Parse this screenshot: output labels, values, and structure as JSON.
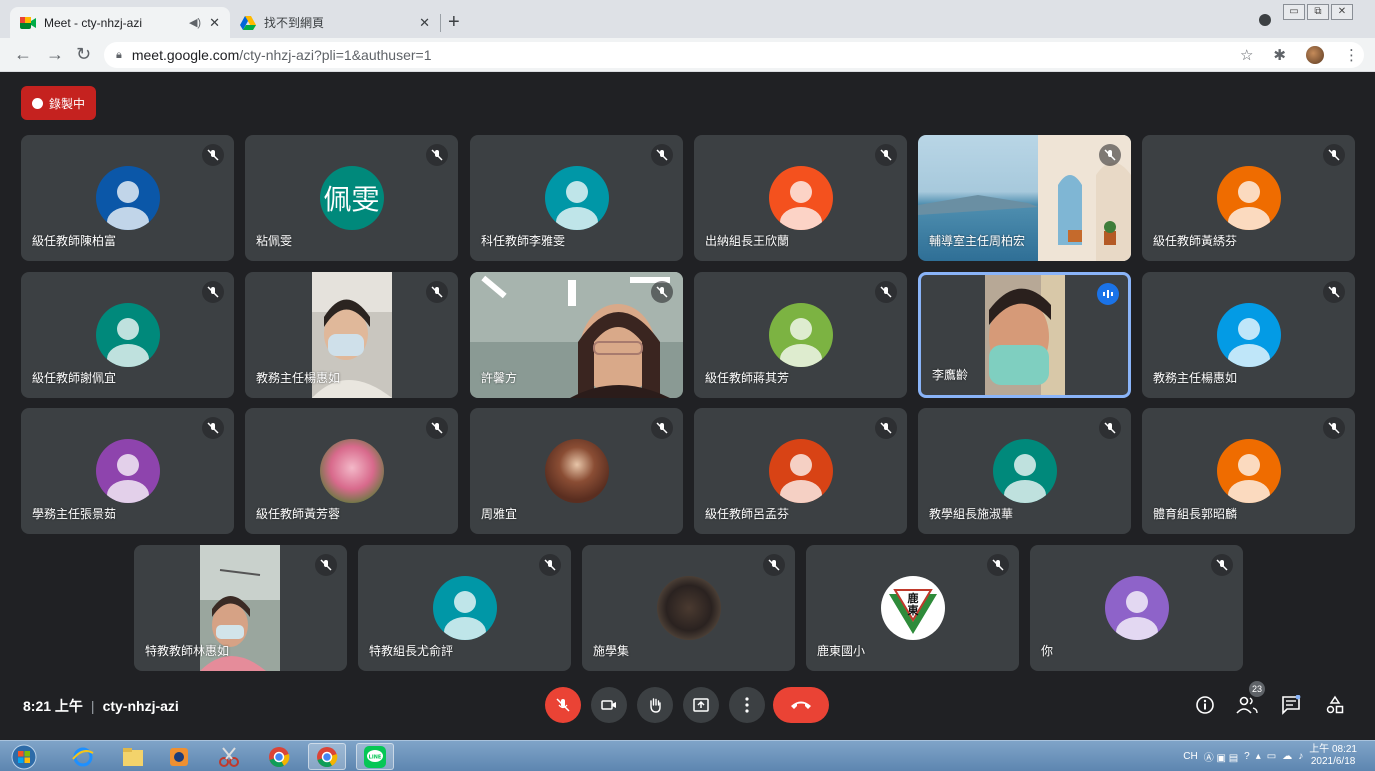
{
  "browser": {
    "tabs": [
      {
        "title": "Meet - cty-nhzj-azi",
        "active": true,
        "icon": "meet-icon",
        "audio_icon": "speaker-icon"
      },
      {
        "title": "找不到網頁",
        "active": false,
        "icon": "drive-icon"
      }
    ],
    "new_tab_label": "+",
    "url_host": "meet.google.com",
    "url_path": "/cty-nhzj-azi?pli=1&authuser=1"
  },
  "meet": {
    "recording_label": "錄製中",
    "rows": [
      [
        {
          "name": "級任教師陳柏富",
          "avatar_color": "#0b57a8",
          "type": "avatar",
          "muted": true
        },
        {
          "name": "粘佩雯",
          "avatar_color": "#00897b",
          "type": "text",
          "avatar_text": "佩雯",
          "muted": true
        },
        {
          "name": "科任教師李雅雯",
          "avatar_color": "#0097a7",
          "type": "avatar",
          "muted": true
        },
        {
          "name": "出納組長王欣蘭",
          "avatar_color": "#f4511e",
          "type": "avatar",
          "muted": true
        },
        {
          "name": "輔導室主任周柏宏",
          "type": "scenery",
          "muted": true
        },
        {
          "name": "級任教師黃綉芬",
          "avatar_color": "#ef6c00",
          "type": "avatar",
          "muted": true
        }
      ],
      [
        {
          "name": "級任教師謝佩宜",
          "avatar_color": "#00897b",
          "type": "avatar",
          "muted": true
        },
        {
          "name": "教務主任楊惠如",
          "type": "video-narrow",
          "muted": true
        },
        {
          "name": "許馨方",
          "type": "video-full",
          "muted": true
        },
        {
          "name": "級任教師蔣其芳",
          "avatar_color": "#7cb342",
          "type": "avatar",
          "muted": true
        },
        {
          "name": "李鷹齡",
          "type": "video-speaking",
          "muted": false,
          "speaking": true
        },
        {
          "name": "教務主任楊惠如",
          "avatar_color": "#039be5",
          "type": "avatar",
          "muted": true
        }
      ],
      [
        {
          "name": "學務主任張景茹",
          "avatar_color": "#8e44ad",
          "type": "avatar",
          "muted": true
        },
        {
          "name": "級任教師黃芳蓉",
          "type": "photo-rose",
          "muted": true
        },
        {
          "name": "周雅宜",
          "type": "photo-person",
          "muted": true
        },
        {
          "name": "級任教師呂孟芬",
          "avatar_color": "#d84315",
          "type": "avatar",
          "muted": true
        },
        {
          "name": "教學組長施淑華",
          "avatar_color": "#00897b",
          "type": "avatar",
          "muted": true
        },
        {
          "name": "體育組長郭昭麟",
          "avatar_color": "#ef6c00",
          "type": "avatar",
          "muted": true
        }
      ],
      [
        {
          "name": "特教教師林惠如",
          "type": "video-narrow2",
          "muted": true
        },
        {
          "name": "特教組長尤俞評",
          "avatar_color": "#0097a7",
          "type": "avatar",
          "muted": true
        },
        {
          "name": "施學集",
          "type": "photo-dark",
          "muted": true
        },
        {
          "name": "鹿東國小",
          "type": "logo",
          "logo_text": "鹿東",
          "muted": true
        },
        {
          "name": "你",
          "avatar_color": "#8e63c9",
          "type": "avatar",
          "muted": true
        }
      ]
    ]
  },
  "bottom_bar": {
    "time": "8:21 上午",
    "separator": "|",
    "meeting_code": "cty-nhzj-azi",
    "participant_count": "23"
  },
  "taskbar": {
    "clock_time": "上午 08:21",
    "clock_date": "2021/6/18",
    "ime": "CH"
  }
}
